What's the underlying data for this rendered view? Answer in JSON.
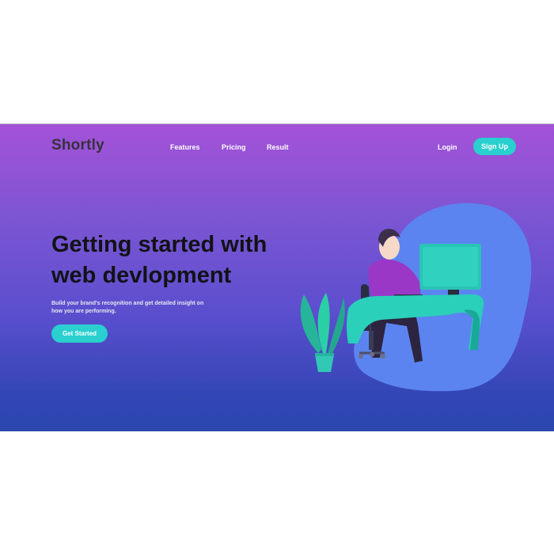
{
  "brand": {
    "logo": "Shortly"
  },
  "nav": {
    "links": [
      "Features",
      "Pricing",
      "Result"
    ],
    "login": "Login",
    "signup": "Sign Up"
  },
  "hero": {
    "title_line1": "Getting started with",
    "title_line2": "web devlopment",
    "subtitle": "Build your brand's recognition and get detailed insight on how you are performing.",
    "cta": "Get Started"
  },
  "colors": {
    "accent": "#2acfcf",
    "gradient_top": "#a452d8",
    "gradient_bottom": "#2b47ae",
    "logo_text": "#35323c",
    "blob": "#5b84f0"
  },
  "illustration": {
    "icon": "person-at-desk-illustration"
  }
}
